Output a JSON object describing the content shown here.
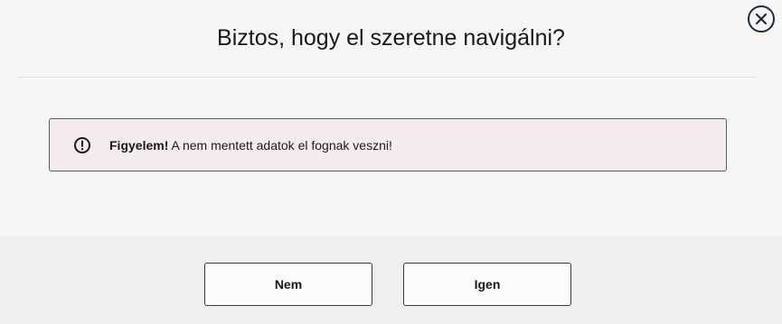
{
  "dialog": {
    "title": "Biztos, hogy el szeretne navigálni?",
    "close_icon": "close-circle-icon",
    "alert": {
      "icon": "exclamation-circle-icon",
      "strong": "Figyelem!",
      "message": "A nem mentett adatok el fognak veszni!"
    },
    "buttons": {
      "no_label": "Nem",
      "yes_label": "Igen"
    },
    "colors": {
      "close_icon": "#1f2a44",
      "alert_background": "#f4ecec",
      "footer_background": "#eef0ee"
    }
  }
}
